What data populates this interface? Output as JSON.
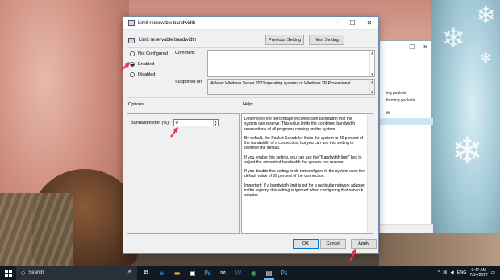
{
  "dialog": {
    "title": "Limit reservable bandwidth",
    "header_title": "Limit reservable bandwidth",
    "prev_button": "Previous Setting",
    "next_button": "Next Setting",
    "radio_not_configured": "Not Configured",
    "radio_enabled": "Enabled",
    "radio_disabled": "Disabled",
    "selected_radio": "Enabled",
    "comment_label": "Comment:",
    "comment_value": "",
    "supported_label": "Supported on:",
    "supported_value": "At least Windows Server 2003 operating systems or Windows XP Professional",
    "options_label": "Options:",
    "help_label": "Help:",
    "bandwidth_label": "Bandwidth limit (%):",
    "bandwidth_value": "0",
    "help_paragraphs": [
      "Determines the percentage of connection bandwidth that the system can reserve. This value limits the combined bandwidth reservations of all programs running on the system.",
      "By default, the Packet Scheduler limits the system to 80 percent of the bandwidth of a connection, but you can use this setting to override the default.",
      "If you enable this setting, you can use the \"Bandwidth limit\" box to adjust the amount of bandwidth the system can reserve.",
      "If you disable this setting or do not configure it, the system uses the default value of 80 percent of the connection.",
      "Important: If a bandwidth limit is set for a particular network adapter in the registry, this setting is ignored when configuring that network adapter."
    ],
    "ok_button": "OK",
    "cancel_button": "Cancel",
    "apply_button": "Apply"
  },
  "background_window": {
    "items": [
      "ing packets",
      "forming packets",
      "ith"
    ]
  },
  "taskbar": {
    "search_placeholder": "Search",
    "language": "ENG",
    "time": "9:47 AM",
    "date": "7/14/2017"
  },
  "colors": {
    "accent": "#0078d7",
    "annotation_arrow": "#e8334a"
  }
}
